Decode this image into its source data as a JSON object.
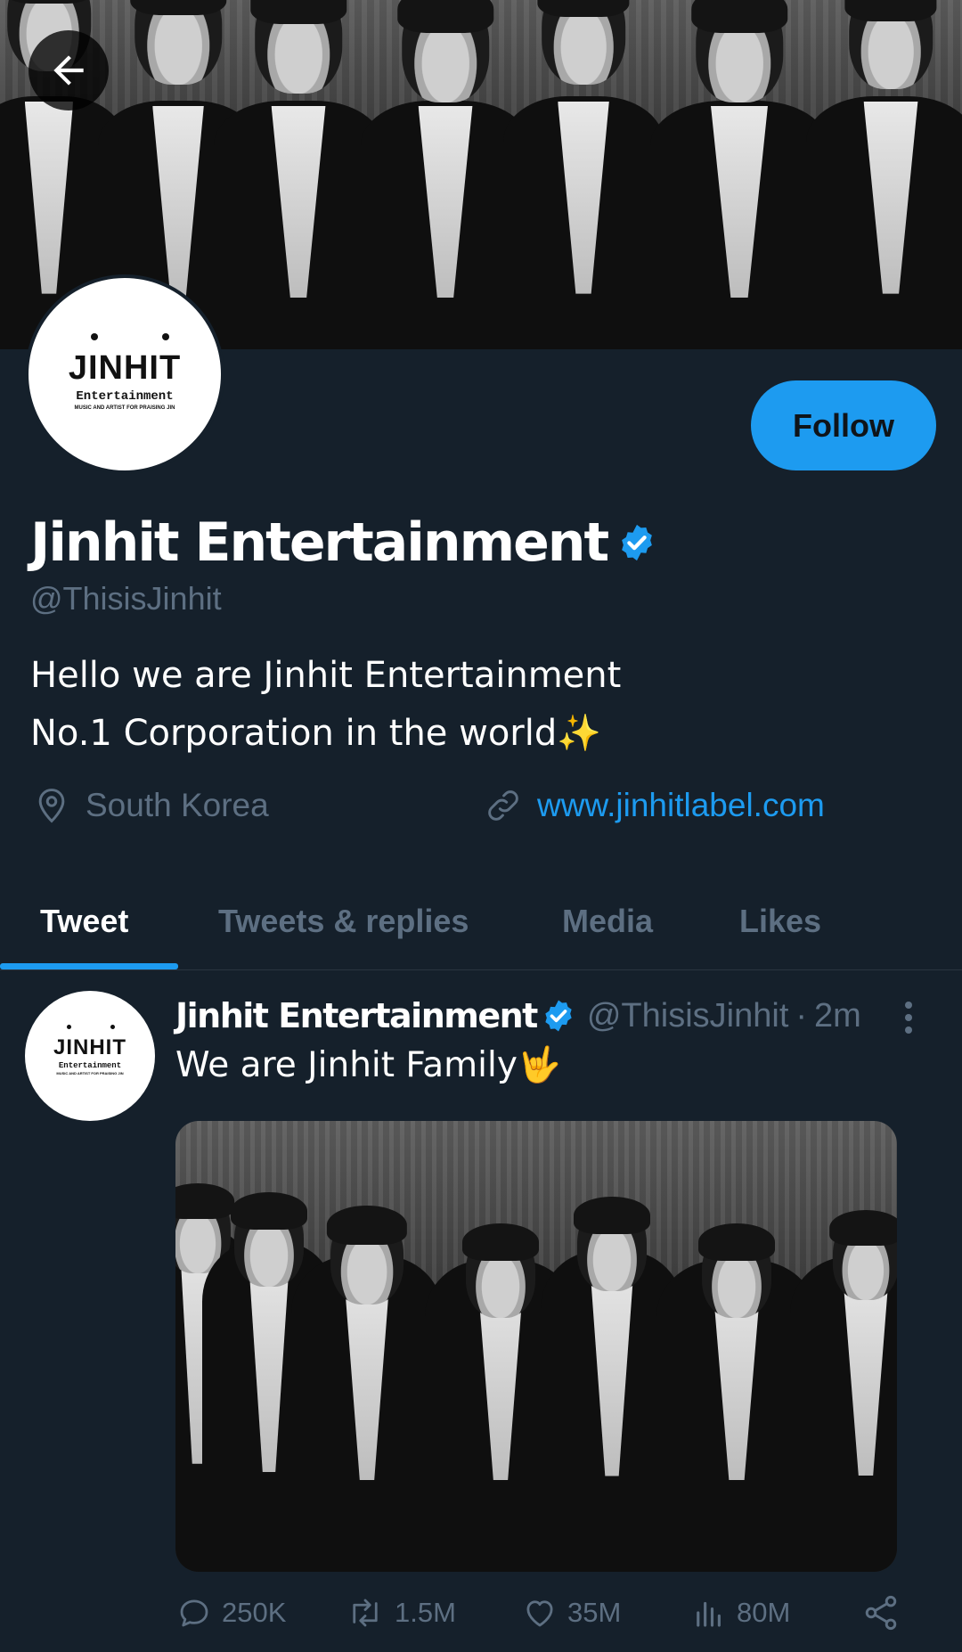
{
  "header": {
    "back_icon": "arrow-left-icon",
    "banner_photo": "group-photo-seven-members-black-white"
  },
  "profile": {
    "logo": {
      "mark": "JINHIT",
      "subtitle": "Entertainment",
      "tagline": "MUSIC AND ARTIST FOR PRAISING JIN"
    },
    "follow_label": "Follow",
    "display_name": "Jinhit Entertainment",
    "verified_icon": "verified-badge-icon",
    "handle": "@ThisisJinhit",
    "bio": {
      "line1": "Hello we are Jinhit Entertainment",
      "line2": "No.1 Corporation in the world",
      "emoji": "✨"
    },
    "location": "South Korea",
    "location_icon": "location-pin-icon",
    "website": "www.jinhitlabel.com",
    "link_icon": "link-icon"
  },
  "tabs": [
    {
      "label": "Tweet",
      "active": true
    },
    {
      "label": "Tweets & replies",
      "active": false
    },
    {
      "label": "Media",
      "active": false
    },
    {
      "label": "Likes",
      "active": false
    }
  ],
  "tweet": {
    "author": "Jinhit Entertainment",
    "handle": "@ThisisJinhit",
    "separator": "·",
    "time": "2m",
    "text": "We are Jinhit Family",
    "emoji": "🤟",
    "more_icon": "more-vertical-icon",
    "stats": {
      "replies": "250K",
      "retweets": "1.5M",
      "likes": "35M",
      "views": "80M"
    }
  },
  "colors": {
    "background": "#15202b",
    "accent": "#1d9bf0",
    "muted": "#5d6f82",
    "text": "#ffffff"
  }
}
